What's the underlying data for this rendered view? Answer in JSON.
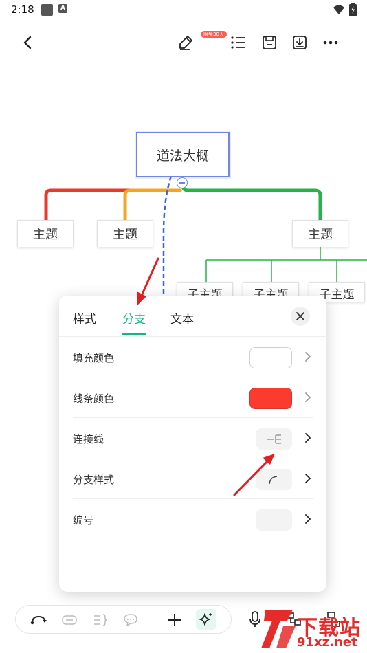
{
  "status_bar": {
    "time": "2:18",
    "notif_letter": "A"
  },
  "toolbar": {
    "badge": "限免30天"
  },
  "mindmap": {
    "root": "道法大概",
    "topics": [
      "主题",
      "主题",
      "主题"
    ],
    "subtopics": [
      "子主题",
      "子主题",
      "子主题"
    ]
  },
  "panel": {
    "tabs": [
      "样式",
      "分支",
      "文本"
    ],
    "active_tab": "分支",
    "rows": [
      {
        "label": "填充颜色"
      },
      {
        "label": "线条颜色"
      },
      {
        "label": "连接线"
      },
      {
        "label": "分支样式"
      },
      {
        "label": "编号"
      }
    ]
  },
  "colors": {
    "accent": "#16b28a",
    "line_color": "#fa3b2d",
    "branch_red": "#e8392a",
    "branch_orange": "#f4a623",
    "branch_green": "#27b24a",
    "branch_blue": "#3a66e0",
    "root_border": "#6f86e6",
    "arrow_red": "#e02020"
  },
  "watermark": {
    "brand": "下载站",
    "url": "91xz.net"
  }
}
